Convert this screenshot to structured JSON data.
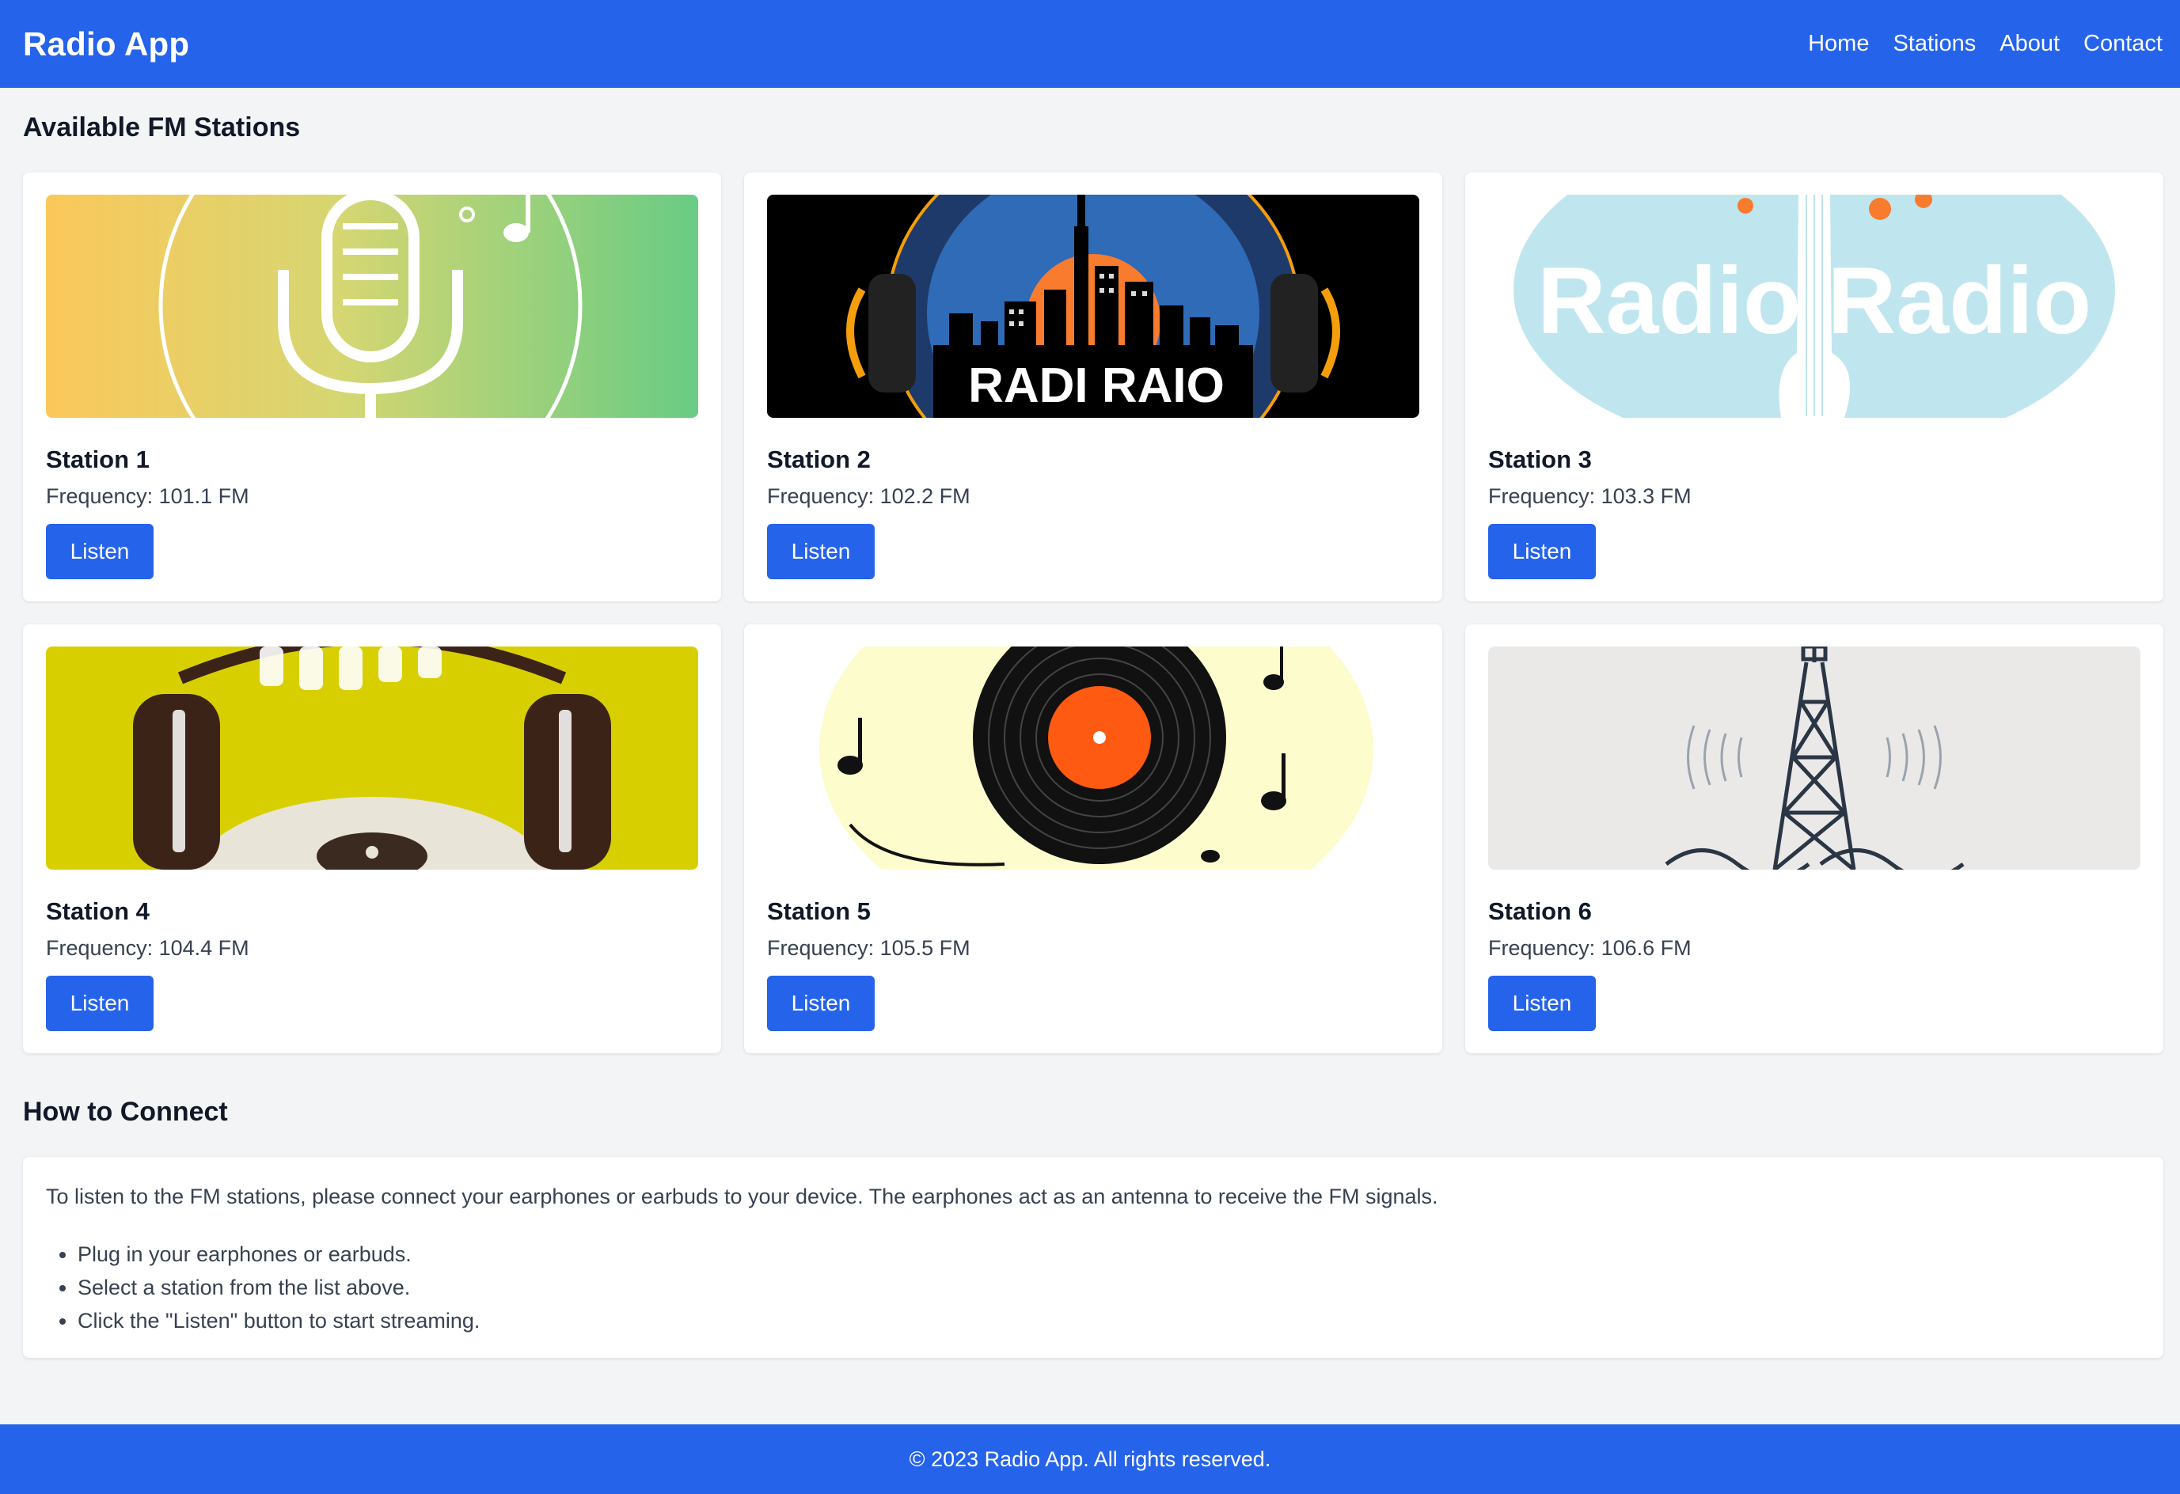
{
  "header": {
    "brand": "Radio App",
    "nav": [
      "Home",
      "Stations",
      "About",
      "Contact"
    ]
  },
  "stations_section": {
    "title": "Available FM Stations",
    "stations": [
      {
        "name": "Station 1",
        "frequency": "Frequency: 101.1 FM",
        "button": "Listen",
        "image": "microphone-gradient-icon"
      },
      {
        "name": "Station 2",
        "frequency": "Frequency: 102.2 FM",
        "button": "Listen",
        "image": "city-headphones-logo",
        "image_text": "RADI RAIO"
      },
      {
        "name": "Station 3",
        "frequency": "Frequency: 103.3 FM",
        "button": "Listen",
        "image": "guitar-radio-logo",
        "image_text": "Radio Radio"
      },
      {
        "name": "Station 4",
        "frequency": "Frequency: 104.4 FM",
        "button": "Listen",
        "image": "headphones-turntable-art"
      },
      {
        "name": "Station 5",
        "frequency": "Frequency: 105.5 FM",
        "button": "Listen",
        "image": "vinyl-record-music-notes"
      },
      {
        "name": "Station 6",
        "frequency": "Frequency: 106.6 FM",
        "button": "Listen",
        "image": "radio-tower-signal"
      }
    ]
  },
  "connect_section": {
    "title": "How to Connect",
    "intro": "To listen to the FM stations, please connect your earphones or earbuds to your device. The earphones act as an antenna to receive the FM signals.",
    "steps": [
      "Plug in your earphones or earbuds.",
      "Select a station from the list above.",
      "Click the \"Listen\" button to start streaming."
    ]
  },
  "footer": {
    "text": "© 2023 Radio App. All rights reserved."
  },
  "colors": {
    "primary": "#2563eb",
    "background": "#f3f4f6",
    "card": "#ffffff"
  }
}
